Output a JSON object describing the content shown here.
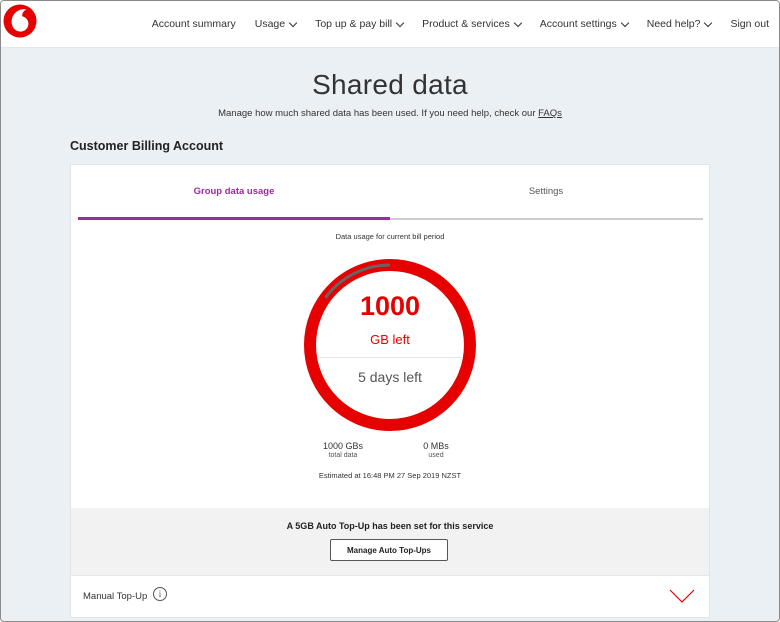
{
  "nav": {
    "logo_icon": "vodafone-logo-icon",
    "items": [
      {
        "label": "Account summary",
        "dropdown": false
      },
      {
        "label": "Usage",
        "dropdown": true
      },
      {
        "label": "Top up & pay bill",
        "dropdown": true
      },
      {
        "label": "Product & services",
        "dropdown": true
      },
      {
        "label": "Account settings",
        "dropdown": true
      },
      {
        "label": "Need help?",
        "dropdown": true
      },
      {
        "label": "Sign out",
        "dropdown": false
      }
    ]
  },
  "header": {
    "title": "Shared data",
    "subtitle": "Manage how much shared data has been used. If you need help, check our",
    "faq_link": "FAQs"
  },
  "section_title": "Customer Billing Account",
  "tabs": [
    {
      "label": "Group data usage",
      "active": true
    },
    {
      "label": "Settings",
      "active": false
    }
  ],
  "usage": {
    "caption": "Data usage for current bill period",
    "remaining_value": "1000",
    "remaining_unit": "GB left",
    "days_left": "5 days left",
    "total_value": "1000 GBs",
    "total_label": "total data",
    "used_value": "0 MBs",
    "used_label": "used",
    "estimate": "Estimated at 16:48 PM 27 Sep 2019 NZST",
    "remaining_fraction": 1.0,
    "period_elapsed_fraction": 0.85
  },
  "auto_topup": {
    "message": "A 5GB Auto Top-Up has been set for this service",
    "button_label": "Manage Auto Top-Ups"
  },
  "manual_topup": {
    "label": "Manual Top-Up",
    "info_glyph": "i",
    "expand_icon": "chevron-down-icon"
  },
  "colors": {
    "brand_red": "#e60000",
    "accent_purple": "#9c2aa0",
    "period_grey": "#666666",
    "page_bg": "#ebf0f5"
  }
}
